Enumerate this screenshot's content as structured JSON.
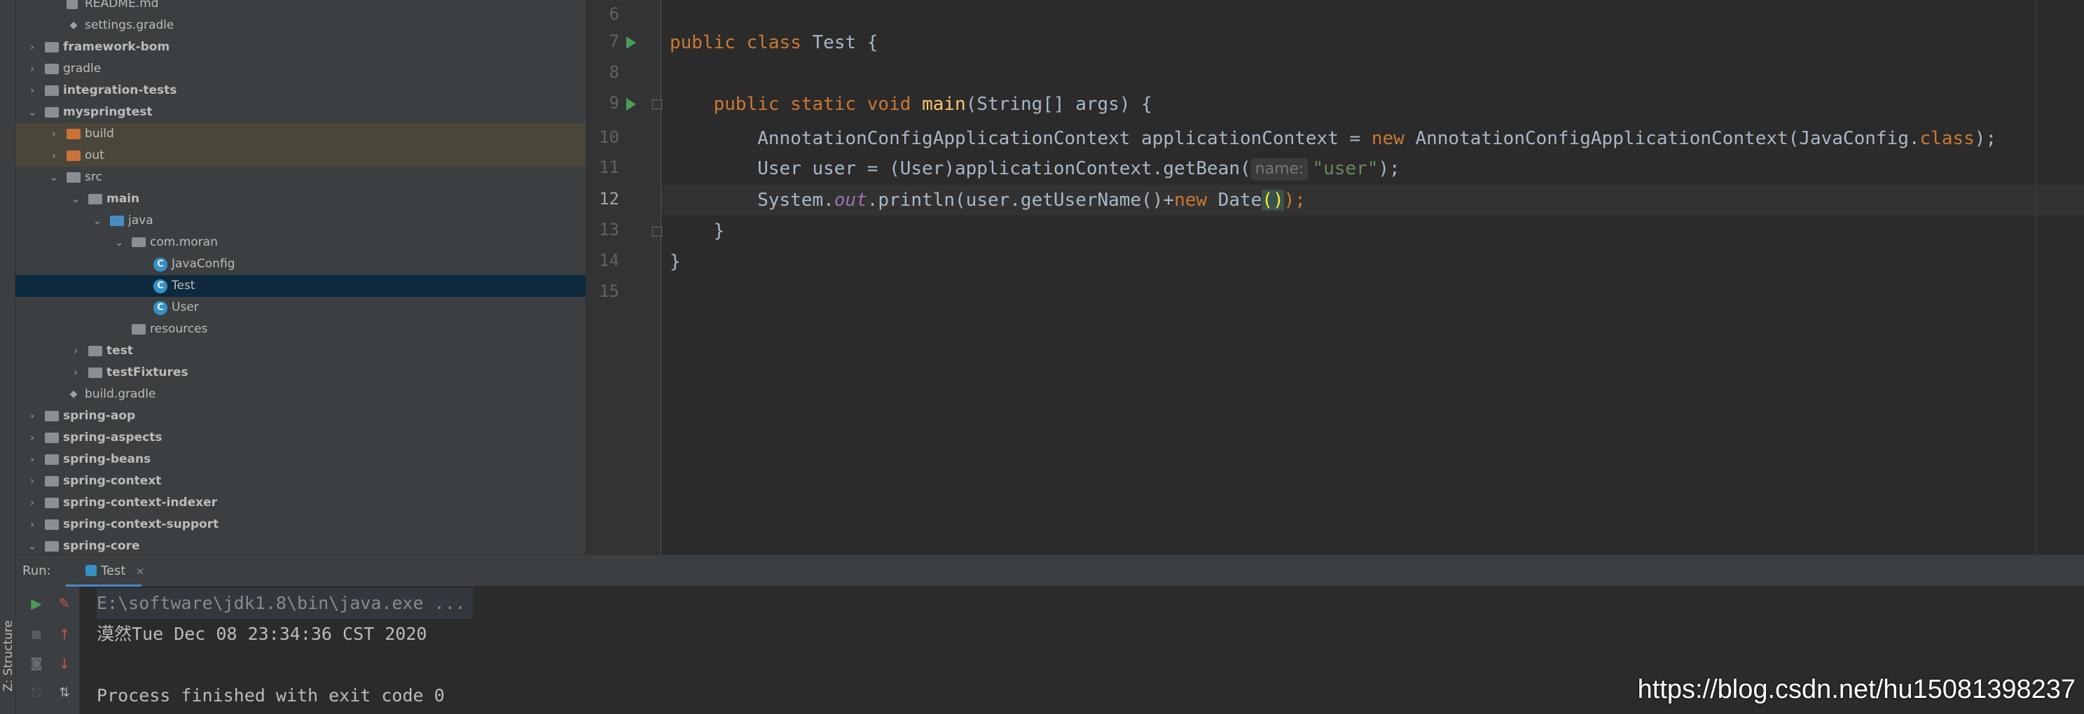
{
  "project_tree": {
    "rows": [
      {
        "label": "README.md",
        "depth": 2,
        "arrow": "",
        "icon": "file-md",
        "bold": false
      },
      {
        "label": "settings.gradle",
        "depth": 2,
        "arrow": "",
        "icon": "gradle",
        "bold": false
      },
      {
        "label": "framework-bom",
        "depth": 1,
        "arrow": "›",
        "icon": "folder",
        "bold": true
      },
      {
        "label": "gradle",
        "depth": 1,
        "arrow": "›",
        "icon": "folder",
        "bold": false
      },
      {
        "label": "integration-tests",
        "depth": 1,
        "arrow": "›",
        "icon": "folder",
        "bold": true
      },
      {
        "label": "myspringtest",
        "depth": 1,
        "arrow": "⌄",
        "icon": "folder",
        "bold": true
      },
      {
        "label": "build",
        "depth": 2,
        "arrow": "›",
        "icon": "folder-orange",
        "bold": false,
        "state": "excluded"
      },
      {
        "label": "out",
        "depth": 2,
        "arrow": "›",
        "icon": "folder-orange",
        "bold": false,
        "state": "excluded"
      },
      {
        "label": "src",
        "depth": 2,
        "arrow": "⌄",
        "icon": "folder",
        "bold": false
      },
      {
        "label": "main",
        "depth": 3,
        "arrow": "⌄",
        "icon": "folder",
        "bold": true
      },
      {
        "label": "java",
        "depth": 4,
        "arrow": "⌄",
        "icon": "folder-blue",
        "bold": false
      },
      {
        "label": "com.moran",
        "depth": 5,
        "arrow": "⌄",
        "icon": "pkg",
        "bold": false
      },
      {
        "label": "JavaConfig",
        "depth": 6,
        "arrow": "",
        "icon": "cls",
        "bold": false
      },
      {
        "label": "Test",
        "depth": 6,
        "arrow": "",
        "icon": "cls",
        "bold": false,
        "state": "selected"
      },
      {
        "label": "User",
        "depth": 6,
        "arrow": "",
        "icon": "cls",
        "bold": false
      },
      {
        "label": "resources",
        "depth": 5,
        "arrow": "",
        "icon": "folder",
        "bold": false
      },
      {
        "label": "test",
        "depth": 3,
        "arrow": "›",
        "icon": "folder",
        "bold": true
      },
      {
        "label": "testFixtures",
        "depth": 3,
        "arrow": "›",
        "icon": "folder",
        "bold": true
      },
      {
        "label": "build.gradle",
        "depth": 2,
        "arrow": "",
        "icon": "gradle",
        "bold": false
      },
      {
        "label": "spring-aop",
        "depth": 1,
        "arrow": "›",
        "icon": "folder",
        "bold": true
      },
      {
        "label": "spring-aspects",
        "depth": 1,
        "arrow": "›",
        "icon": "folder",
        "bold": true
      },
      {
        "label": "spring-beans",
        "depth": 1,
        "arrow": "›",
        "icon": "folder",
        "bold": true
      },
      {
        "label": "spring-context",
        "depth": 1,
        "arrow": "›",
        "icon": "folder",
        "bold": true
      },
      {
        "label": "spring-context-indexer",
        "depth": 1,
        "arrow": "›",
        "icon": "folder",
        "bold": true
      },
      {
        "label": "spring-context-support",
        "depth": 1,
        "arrow": "›",
        "icon": "folder",
        "bold": true
      },
      {
        "label": "spring-core",
        "depth": 1,
        "arrow": "⌄",
        "icon": "folder",
        "bold": true
      }
    ]
  },
  "editor": {
    "line_numbers": [
      "6",
      "7",
      "8",
      "9",
      "10",
      "11",
      "12",
      "13",
      "14",
      "15"
    ],
    "current_line": "12",
    "lines": {
      "l7": {
        "k1": "public",
        "k2": "class",
        "rest": " Test {"
      },
      "l9": {
        "k1": "public",
        "k2": "static",
        "k3": "void",
        "fn": "main",
        "rest": "(String[] args) {"
      },
      "l10": {
        "a": "AnnotationConfigApplicationContext applicationContext = ",
        "kw": "new",
        "b": " AnnotationConfigApplicationContext(JavaConfig.",
        "kw2": "class",
        "c": ");"
      },
      "l11": {
        "a": "User user = (User)applicationContext.getBean(",
        "hint": "name:",
        "str": "\"user\"",
        "c": ");"
      },
      "l12": {
        "a": "System.",
        "fld": "out",
        "b": ".println(user.getUserName()+",
        "kw": "new",
        "c": " Date",
        "paren": "()",
        "d": ");"
      },
      "l13": {
        "text": "}"
      },
      "l14": {
        "text": "}"
      }
    }
  },
  "run_window": {
    "title": "Run:",
    "tab_label": "Test",
    "tab_close": "×",
    "console": [
      "E:\\software\\jdk1.8\\bin\\java.exe ...",
      "漠然Tue Dec 08 23:34:36 CST 2020",
      "",
      "Process finished with exit code 0"
    ]
  },
  "side_tab": {
    "label": "Z: Structure"
  },
  "watermark": "https://blog.csdn.net/hu15081398237",
  "colors": {
    "keyword": "#cc7832",
    "function": "#ffc66d",
    "string": "#6a8759",
    "field": "#9876aa",
    "selection": "#0d293e",
    "run_green": "#499c54"
  }
}
